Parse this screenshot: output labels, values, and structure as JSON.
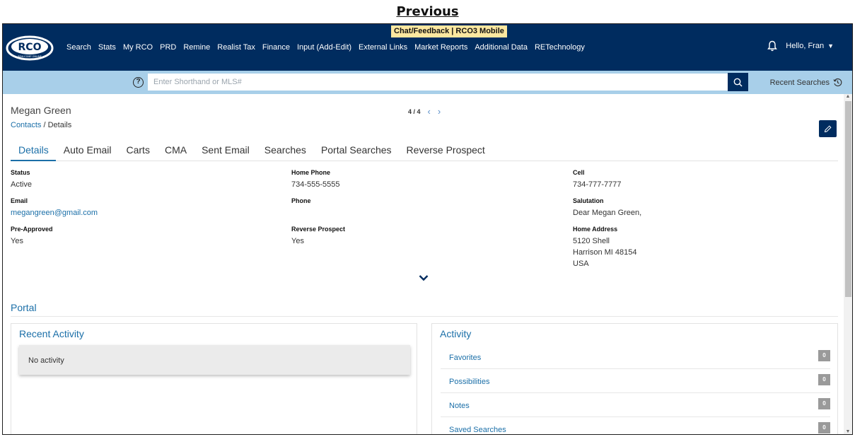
{
  "caption": "Previous",
  "banner": {
    "text": "Chat/Feedback | RCO3 Mobile"
  },
  "logo": {
    "text": "RCO",
    "subtext": "REALCOMP ONLINE"
  },
  "nav": {
    "items": [
      "Search",
      "Stats",
      "My RCO",
      "PRD",
      "Remine",
      "Realist Tax",
      "Finance",
      "Input (Add-Edit)",
      "External Links",
      "Market Reports",
      "Additional Data",
      "RETechnology"
    ],
    "greeting": "Hello, Fran"
  },
  "search": {
    "placeholder": "Enter Shorthand or MLS#",
    "value": "",
    "recent_label": "Recent Searches"
  },
  "contact": {
    "name": "Megan Green",
    "breadcrumb_link": "Contacts",
    "breadcrumb_sep": " / ",
    "breadcrumb_current": "Details",
    "pager": "4 / 4"
  },
  "tabs": [
    "Details",
    "Auto Email",
    "Carts",
    "CMA",
    "Sent Email",
    "Searches",
    "Portal Searches",
    "Reverse Prospect"
  ],
  "details": {
    "status_label": "Status",
    "status": "Active",
    "home_phone_label": "Home Phone",
    "home_phone": "734-555-5555",
    "cell_label": "Cell",
    "cell": "734-777-7777",
    "email_label": "Email",
    "email": "megangreen@gmail.com",
    "phone_label": "Phone",
    "phone": "",
    "salutation_label": "Salutation",
    "salutation": "Dear Megan Green,",
    "preapproved_label": "Pre-Approved",
    "preapproved": "Yes",
    "reverse_prospect_label": "Reverse Prospect",
    "reverse_prospect": "Yes",
    "home_address_label": "Home Address",
    "address_line1": "5120 Shell",
    "address_line2": "Harrison MI 48154",
    "address_line3": "USA"
  },
  "portal": {
    "title": "Portal",
    "recent_activity_title": "Recent Activity",
    "no_activity": "No activity",
    "activity_title": "Activity",
    "activity_rows": [
      {
        "label": "Favorites",
        "count": "0"
      },
      {
        "label": "Possibilities",
        "count": "0"
      },
      {
        "label": "Notes",
        "count": "0"
      },
      {
        "label": "Saved Searches",
        "count": "0"
      }
    ]
  },
  "colors": {
    "navbar": "#002c5f",
    "searchbar": "#a8cfe9",
    "link": "#1b6fa8",
    "banner": "#fde7a0"
  }
}
